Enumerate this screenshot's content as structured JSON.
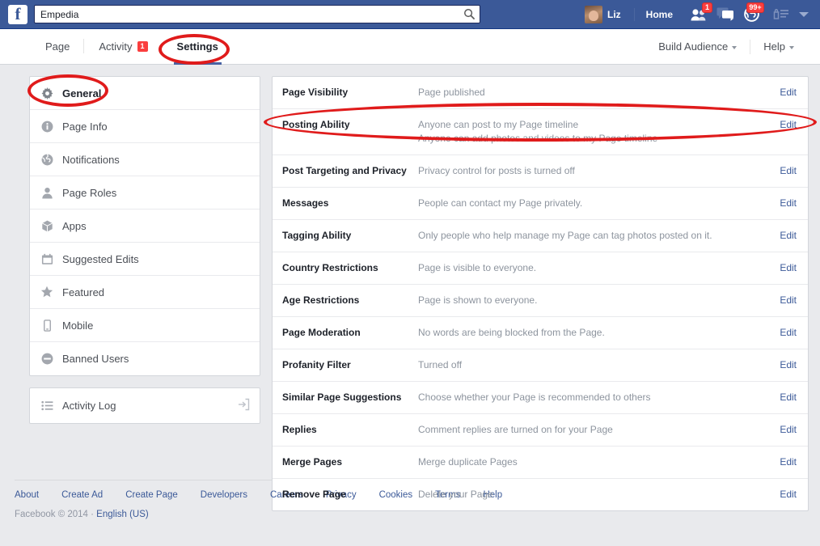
{
  "topbar": {
    "logo": "f",
    "search": {
      "value": "Empedia",
      "placeholder": "Search",
      "icon": "search-icon"
    },
    "user_name": "Liz",
    "home_label": "Home",
    "icons": [
      {
        "name": "friend-requests-icon",
        "badge": "1"
      },
      {
        "name": "messages-icon",
        "badge": ""
      },
      {
        "name": "notifications-globe-icon",
        "badge": "99+"
      },
      {
        "name": "privacy-lock-icon",
        "badge": ""
      }
    ]
  },
  "pagenav": {
    "tabs": [
      {
        "label": "Page",
        "badge": "",
        "active": false
      },
      {
        "label": "Activity",
        "badge": "1",
        "active": false
      },
      {
        "label": "Settings",
        "badge": "",
        "active": true
      }
    ],
    "build_audience": "Build Audience",
    "help": "Help"
  },
  "sidebar": {
    "items": [
      {
        "label": "General",
        "icon": "gear-icon",
        "active": true
      },
      {
        "label": "Page Info",
        "icon": "info-icon",
        "active": false
      },
      {
        "label": "Notifications",
        "icon": "globe-icon",
        "active": false
      },
      {
        "label": "Page Roles",
        "icon": "person-icon",
        "active": false
      },
      {
        "label": "Apps",
        "icon": "box-icon",
        "active": false
      },
      {
        "label": "Suggested Edits",
        "icon": "calendar-icon",
        "active": false
      },
      {
        "label": "Featured",
        "icon": "star-icon",
        "active": false
      },
      {
        "label": "Mobile",
        "icon": "mobile-phone-icon",
        "active": false
      },
      {
        "label": "Banned Users",
        "icon": "minus-circle-icon",
        "active": false
      }
    ],
    "activity_log": {
      "label": "Activity Log",
      "icon": "list-icon",
      "external_icon": "external-link-icon"
    }
  },
  "settings": {
    "edit_label": "Edit",
    "rows": [
      {
        "label": "Page Visibility",
        "value": "Page published"
      },
      {
        "label": "Posting Ability",
        "value": "Anyone can post to my Page timeline",
        "value2": "Anyone can add photos and videos to my Page timeline"
      },
      {
        "label": "Post Targeting and Privacy",
        "value": "Privacy control for posts is turned off"
      },
      {
        "label": "Messages",
        "value": "People can contact my Page privately."
      },
      {
        "label": "Tagging Ability",
        "value": "Only people who help manage my Page can tag photos posted on it."
      },
      {
        "label": "Country Restrictions",
        "value": "Page is visible to everyone."
      },
      {
        "label": "Age Restrictions",
        "value": "Page is shown to everyone."
      },
      {
        "label": "Page Moderation",
        "value": "No words are being blocked from the Page."
      },
      {
        "label": "Profanity Filter",
        "value": "Turned off"
      },
      {
        "label": "Similar Page Suggestions",
        "value": "Choose whether your Page is recommended to others"
      },
      {
        "label": "Replies",
        "value": "Comment replies are turned on for your Page"
      },
      {
        "label": "Merge Pages",
        "value": "Merge duplicate Pages"
      },
      {
        "label": "Remove Page",
        "value": "Delete your Page"
      }
    ]
  },
  "footer": {
    "links": [
      "About",
      "Create Ad",
      "Create Page",
      "Developers",
      "Careers",
      "Privacy",
      "Cookies",
      "Terms",
      "Help"
    ],
    "copyright": "Facebook © 2014 · ",
    "language": "English (US)"
  },
  "annotations": {
    "color": "#e01b1b",
    "shapes": [
      {
        "name": "settings-tab-highlight"
      },
      {
        "name": "general-sidebar-highlight"
      },
      {
        "name": "posting-ability-row-highlight"
      }
    ]
  }
}
